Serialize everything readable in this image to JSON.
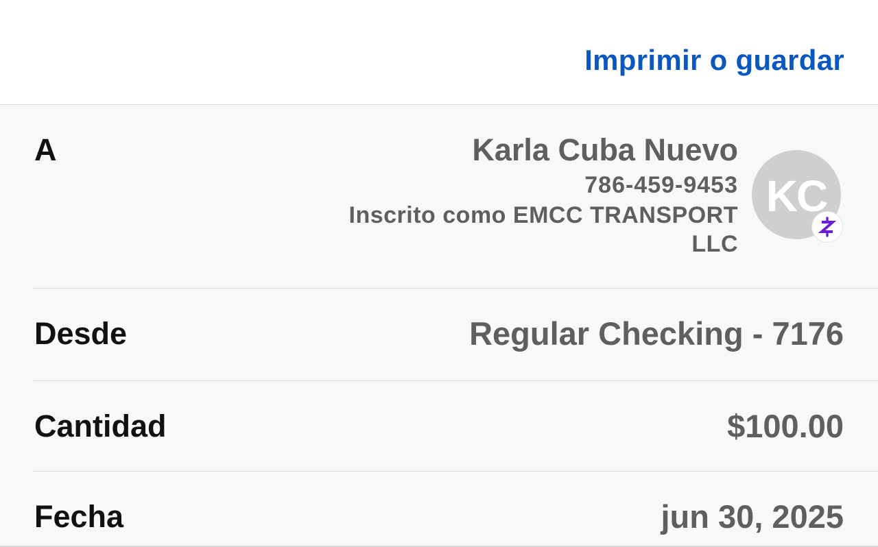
{
  "header": {
    "print_label": "Imprimir o guardar"
  },
  "details": {
    "to": {
      "label": "A",
      "name": "Karla Cuba Nuevo",
      "phone": "786-459-9453",
      "enrolled_as": "Inscrito como EMCC TRANSPORT LLC",
      "avatar_initials": "KC",
      "badge_icon": "zelle-icon"
    },
    "from": {
      "label": "Desde",
      "value": "Regular Checking - 7176"
    },
    "amount": {
      "label": "Cantidad",
      "value": "$100.00"
    },
    "date": {
      "label": "Fecha",
      "value": "jun 30, 2025"
    }
  },
  "colors": {
    "link": "#0b57c0",
    "label": "#111111",
    "value": "#5f5f5f",
    "avatar_bg": "#cfcfcf",
    "zelle_purple": "#6d1ed4"
  }
}
